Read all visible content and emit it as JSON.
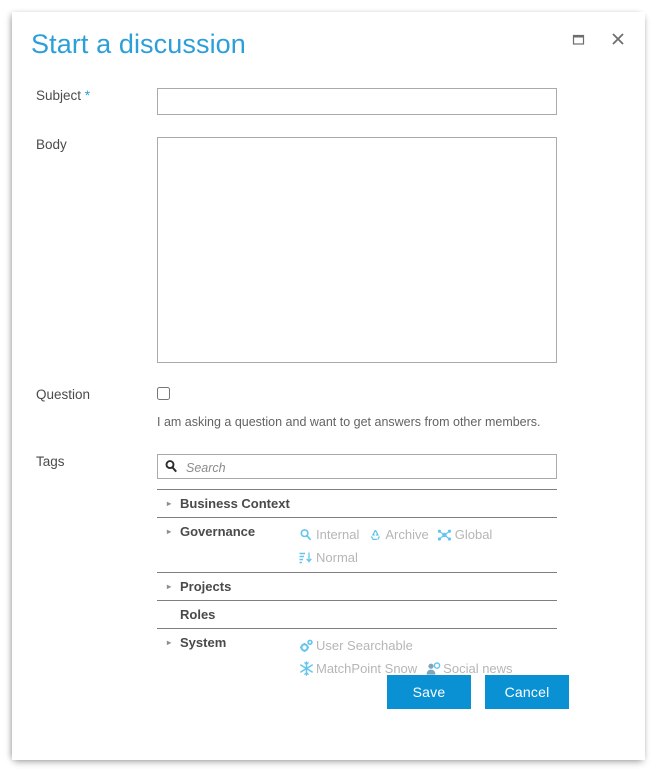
{
  "dialog": {
    "title": "Start a discussion",
    "window_controls": [
      {
        "name": "maximize",
        "icon": "maximize-icon",
        "label": "Maximize"
      },
      {
        "name": "close",
        "icon": "close-icon",
        "label": "Close"
      }
    ]
  },
  "form": {
    "subject": {
      "label": "Subject",
      "required_marker": "*",
      "value": "",
      "placeholder": ""
    },
    "body": {
      "label": "Body",
      "value": "",
      "placeholder": ""
    },
    "question": {
      "label": "Question",
      "checked": false,
      "hint": "I am asking a question and want to get answers from other members."
    },
    "tags": {
      "label": "Tags",
      "search": {
        "value": "",
        "placeholder": "Search",
        "icon": "search-icon"
      },
      "categories": [
        {
          "name": "Business Context",
          "expandable": true,
          "items": []
        },
        {
          "name": "Governance",
          "expandable": true,
          "items": [
            {
              "label": "Internal",
              "icon": "magnifier-icon"
            },
            {
              "label": "Archive",
              "icon": "recycle-icon"
            },
            {
              "label": "Global",
              "icon": "network-icon"
            },
            {
              "label": "Normal",
              "icon": "sort-descending-icon"
            }
          ]
        },
        {
          "name": "Projects",
          "expandable": true,
          "items": []
        },
        {
          "name": "Roles",
          "expandable": false,
          "items": []
        },
        {
          "name": "System",
          "expandable": true,
          "items": [
            {
              "label": "User Searchable",
              "icon": "gears-icon"
            },
            {
              "label": "MatchPoint Snow",
              "icon": "snowflake-icon"
            },
            {
              "label": "Social news",
              "icon": "user-icon"
            }
          ]
        }
      ]
    }
  },
  "footer": {
    "save_label": "Save",
    "cancel_label": "Cancel"
  },
  "colors": {
    "title_blue": "#2c9fd9",
    "button_blue": "#0a91d4",
    "tag_icon_blue": "#63c5ee",
    "tag_text_gray": "#b6b6b6",
    "border_gray": "#aaaaaa"
  }
}
